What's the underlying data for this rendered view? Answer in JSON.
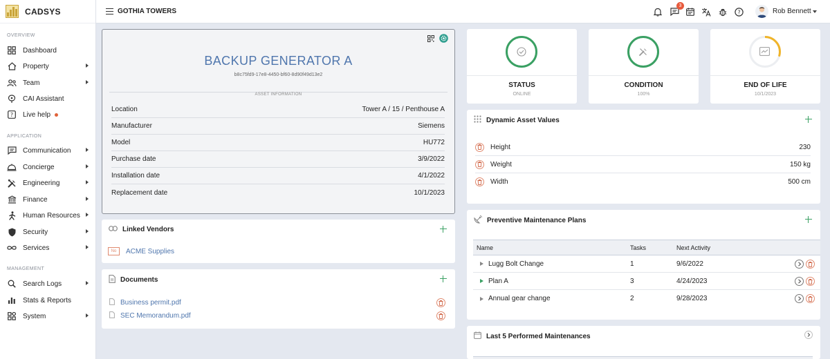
{
  "app": {
    "name": "CADSYS"
  },
  "topbar": {
    "building": "GOTHIA TOWERS",
    "messages_badge": "3",
    "user_name": "Rob Bennett"
  },
  "sidebar": {
    "sections": {
      "overview": "OVERVIEW",
      "application": "APPLICATION",
      "management": "MANAGEMENT"
    },
    "items": {
      "dashboard": "Dashboard",
      "property": "Property",
      "team": "Team",
      "cai": "CAI Assistant",
      "live_help": "Live help",
      "communication": "Communication",
      "concierge": "Concierge",
      "engineering": "Engineering",
      "finance": "Finance",
      "hr": "Human Resources",
      "security": "Security",
      "services": "Services",
      "search_logs": "Search Logs",
      "stats": "Stats & Reports",
      "system": "System"
    }
  },
  "asset": {
    "title": "BACKUP GENERATOR A",
    "uuid": "b8c75fd9-17e8-4450-bf60-8d90f49d13e2",
    "info_label": "ASSET INFORMATION",
    "rows": [
      {
        "label": "Location",
        "value": "Tower A / 15 / Penthouse A"
      },
      {
        "label": "Manufacturer",
        "value": "Siemens"
      },
      {
        "label": "Model",
        "value": "HU772"
      },
      {
        "label": "Purchase date",
        "value": "3/9/2022"
      },
      {
        "label": "Installation date",
        "value": "4/1/2022"
      },
      {
        "label": "Replacement date",
        "value": "10/1/2023"
      }
    ]
  },
  "vendors": {
    "title": "Linked Vendors",
    "items": [
      {
        "name": "ACME Supplies",
        "logo_text": "No"
      }
    ]
  },
  "documents": {
    "title": "Documents",
    "items": [
      {
        "name": "Business permit.pdf"
      },
      {
        "name": "SEC Memorandum.pdf"
      }
    ]
  },
  "kpis": {
    "status": {
      "label": "STATUS",
      "value": "ONLINE"
    },
    "condition": {
      "label": "CONDITION",
      "value": "100%",
      "level": 1.0
    },
    "end_of_life": {
      "label": "END OF LIFE",
      "value": "10/1/2023",
      "level": 0.3
    }
  },
  "dynamic_values": {
    "title": "Dynamic Asset Values",
    "rows": [
      {
        "label": "Height",
        "value": "230"
      },
      {
        "label": "Weight",
        "value": "150 kg"
      },
      {
        "label": "Width",
        "value": "500 cm"
      }
    ]
  },
  "pm_plans": {
    "title": "Preventive Maintenance Plans",
    "columns": {
      "name": "Name",
      "tasks": "Tasks",
      "next": "Next Activity"
    },
    "rows": [
      {
        "name": "Lugg Bolt Change",
        "tasks": "1",
        "next": "9/6/2022"
      },
      {
        "name": "Plan A",
        "tasks": "3",
        "next": "4/24/2023"
      },
      {
        "name": "Annual gear change",
        "tasks": "2",
        "next": "9/28/2023"
      }
    ]
  },
  "last_maint": {
    "title": "Last 5 Performed Maintenances"
  },
  "colors": {
    "accent_blue": "#4f76ad",
    "ok_green": "#3aa063",
    "warning_yellow": "#f0b429",
    "badge_red": "#e85a3c"
  }
}
